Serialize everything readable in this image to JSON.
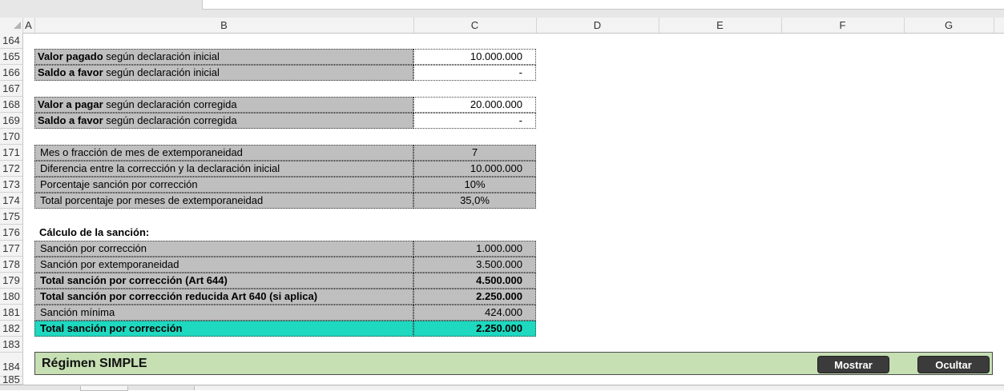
{
  "columns": [
    "A",
    "B",
    "C",
    "D",
    "E",
    "F",
    "G"
  ],
  "rows": [
    "164",
    "165",
    "166",
    "167",
    "168",
    "169",
    "170",
    "171",
    "172",
    "173",
    "174",
    "175",
    "176",
    "177",
    "178",
    "179",
    "180",
    "181",
    "182",
    "183",
    "184",
    "185"
  ],
  "block1": {
    "r165": {
      "label_bold": "Valor pagado",
      "label_rest": " según declaración inicial",
      "value": "10.000.000"
    },
    "r166": {
      "label_bold": "Saldo a favor",
      "label_rest": " según declaración inicial",
      "value": "-"
    }
  },
  "block2": {
    "r168": {
      "label_bold": "Valor a pagar",
      "label_rest": " según declaración corregida",
      "value": "20.000.000"
    },
    "r169": {
      "label_bold": "Saldo a favor",
      "label_rest": " según declaración corregida",
      "value": "-"
    }
  },
  "block3": [
    {
      "label": "Mes o fracción de mes de extemporaneidad",
      "value": "7"
    },
    {
      "label": "Diferencia entre la corrección y la declaración inicial",
      "value": "10.000.000"
    },
    {
      "label": "Porcentaje sanción por corrección",
      "value": "10%"
    },
    {
      "label": "Total porcentaje por meses de extemporaneidad",
      "value": "35,0%"
    }
  ],
  "calc_title": "Cálculo de la sanción:",
  "block4": [
    {
      "label": "Sanción por corrección",
      "value": "1.000.000"
    },
    {
      "label": "Sanción por extemporaneidad",
      "value": "3.500.000"
    },
    {
      "label": "Total sanción por corrección (Art 644)",
      "value": "4.500.000"
    },
    {
      "label": "Total sanción por corrección reducida Art 640 (si aplica)",
      "value": "2.250.000"
    },
    {
      "label": "Sanción mínima",
      "value": "424.000"
    },
    {
      "label": "Total sanción por corrección",
      "value": "2.250.000"
    }
  ],
  "banner": {
    "title": "Régimen SIMPLE",
    "show_label": "Mostrar",
    "hide_label": "Ocultar"
  },
  "colors": {
    "teal_highlight": "#1ed8c0",
    "banner_bg": "#c6dfb3",
    "label_gray": "#bfbfbf"
  }
}
